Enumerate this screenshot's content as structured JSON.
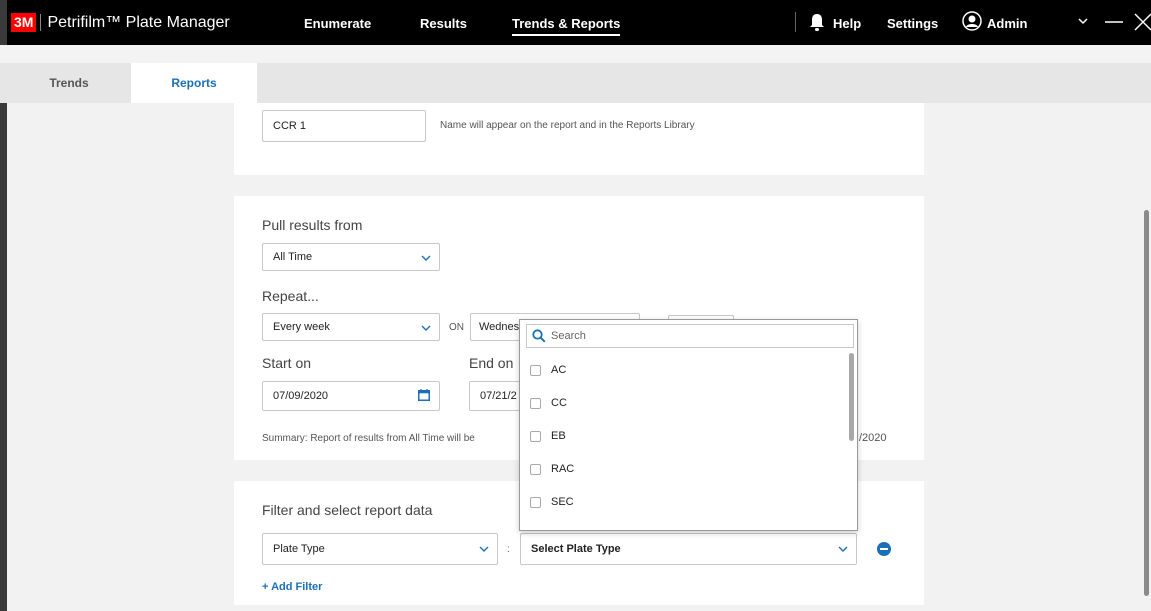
{
  "app": {
    "logo": "3M",
    "title": "Petrifilm™ Plate Manager"
  },
  "nav": {
    "items": [
      "Enumerate",
      "Results",
      "Trends & Reports"
    ],
    "active": "Trends & Reports",
    "help": "Help",
    "settings": "Settings",
    "user": "Admin"
  },
  "window": {
    "minimize": "—",
    "close": "✕",
    "menu": "⌄"
  },
  "tabs": [
    "Trends",
    "Reports"
  ],
  "report": {
    "name_value": "CCR 1",
    "name_hint": "Name will appear on the report and in the Reports Library"
  },
  "schedule": {
    "pull_label": "Pull results from",
    "pull_value": "All Time",
    "repeat_label": "Repeat...",
    "repeat_value": "Every week",
    "on_label": "ON",
    "day_value": "Wednes",
    "start_label": "Start on",
    "start_value": "07/09/2020",
    "end_label": "End on",
    "end_value": "07/21/2",
    "summary_start": "Summary: Report of results from All Time will be",
    "summary_end": "/2020"
  },
  "filter": {
    "section_label": "Filter and select report data",
    "field_value": "Plate Type",
    "separator": ":",
    "select_placeholder": "Select Plate Type",
    "add_filter": "+ Add Filter"
  },
  "dropdown": {
    "search_placeholder": "Search",
    "options": [
      "AC",
      "CC",
      "EB",
      "RAC",
      "SEC"
    ]
  },
  "colors": {
    "accent": "#1b6fb8",
    "topbar": "#000000",
    "brand_red": "#ff0000"
  }
}
